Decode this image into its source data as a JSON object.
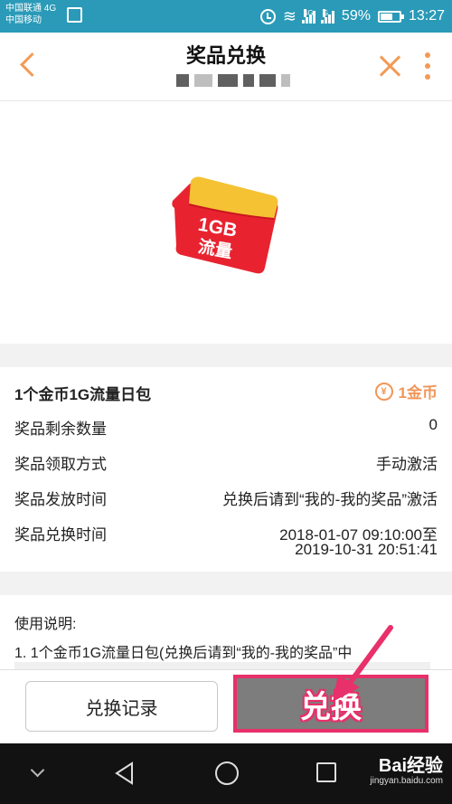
{
  "status_bar": {
    "carrier1": "中国联通 4G",
    "carrier2": "中国移动",
    "network": "4G",
    "network2": "G",
    "battery": "59%",
    "time": "13:27"
  },
  "nav": {
    "title": "奖品兑换"
  },
  "envelope": {
    "line1": "1GB",
    "line2": "流量"
  },
  "prize": {
    "name": "1个金币1G流量日包",
    "coin_symbol": "¥",
    "price": "1金币",
    "rows": [
      {
        "label": "奖品剩余数量",
        "value": "0"
      },
      {
        "label": "奖品领取方式",
        "value": "手动激活"
      },
      {
        "label": "奖品发放时间",
        "value": "兑换后请到“我的-我的奖品”激活"
      },
      {
        "label": "奖品兑换时间",
        "value": "2018-01-07 09:10:00至",
        "value2": "2019-10-31 20:51:41"
      }
    ]
  },
  "usage": {
    "title": "使用说明:",
    "line1": "1. 1个金币1G流量日包(兑换后请到“我的-我的奖品”中"
  },
  "actions": {
    "record_label": "兑换记录",
    "exchange_label": "兑换"
  },
  "watermark": {
    "brand": "Bai经验",
    "site": "jingyan.baidu.com"
  },
  "colors": {
    "status_bar": "#2a9ab8",
    "accent": "#f29a55",
    "highlight": "#e8306a"
  }
}
